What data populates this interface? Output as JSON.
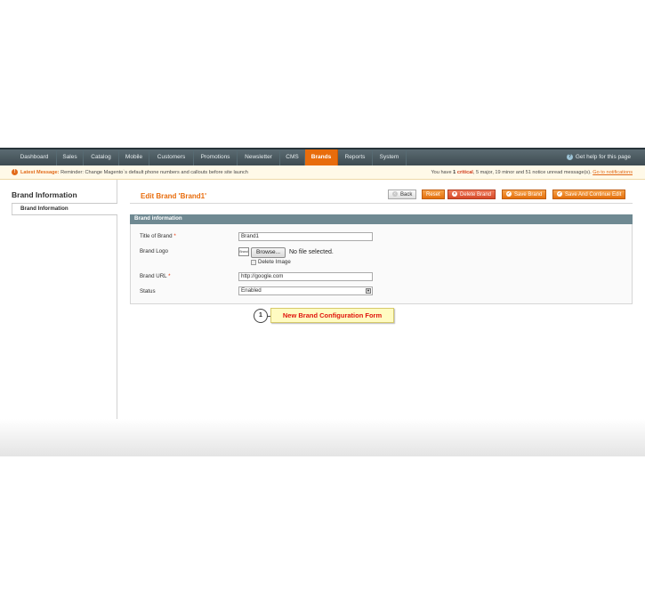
{
  "nav": {
    "items": [
      {
        "label": "Dashboard",
        "active": false
      },
      {
        "label": "Sales",
        "active": false
      },
      {
        "label": "Catalog",
        "active": false
      },
      {
        "label": "Mobile",
        "active": false
      },
      {
        "label": "Customers",
        "active": false
      },
      {
        "label": "Promotions",
        "active": false
      },
      {
        "label": "Newsletter",
        "active": false
      },
      {
        "label": "CMS",
        "active": false
      },
      {
        "label": "Brands",
        "active": true
      },
      {
        "label": "Reports",
        "active": false
      },
      {
        "label": "System",
        "active": false
      }
    ],
    "help": "Get help for this page"
  },
  "message": {
    "latest_label": "Latest Message:",
    "latest_text": "Reminder: Change Magento`s default phone numbers and callouts before site launch",
    "you_have": "You have",
    "critical_count": "1",
    "critical_label": "critical",
    "major": ", 5 major, 19 minor and 51 notice unread message(s).",
    "link": "Go to notifications"
  },
  "sidebar": {
    "title": "Brand Information",
    "tab": "Brand Information"
  },
  "header": {
    "title": "Edit Brand 'Brand1'",
    "buttons": {
      "back": "Back",
      "reset": "Reset",
      "delete": "Delete Brand",
      "save": "Save Brand",
      "save_continue": "Save And Continue Edit"
    }
  },
  "form": {
    "section_title": "Brand information",
    "title_label": "Title of Brand",
    "title_value": "Brand1",
    "logo_label": "Brand Logo",
    "logo_thumb": "Brand",
    "browse": "Browse...",
    "no_file": "No file selected.",
    "delete_image": "Delete Image",
    "url_label": "Brand URL",
    "url_value": "http://google.com",
    "status_label": "Status",
    "status_value": "Enabled",
    "required_mark": "*"
  },
  "callout": {
    "number": "1",
    "text": "New Brand Configuration Form"
  },
  "colors": {
    "accent": "#e86c0c",
    "nav_bg": "#4a585e",
    "section_head": "#6f8992",
    "callout_text": "#e0140c"
  }
}
